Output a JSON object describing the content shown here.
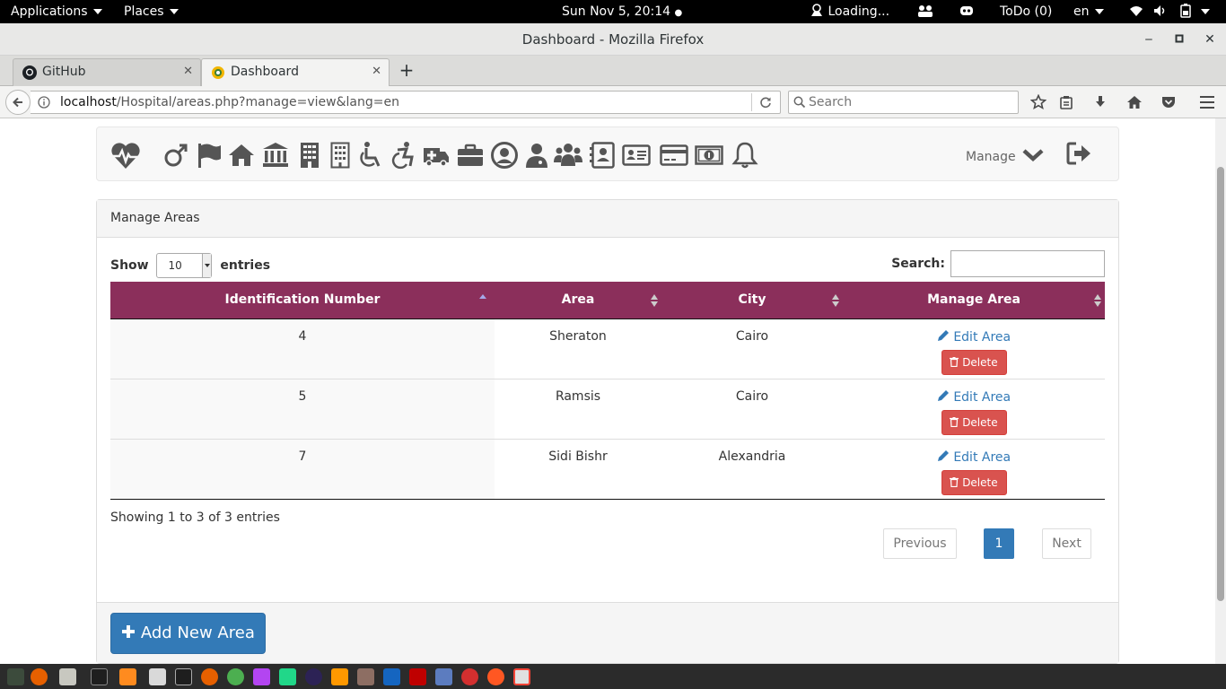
{
  "topbar": {
    "applications": "Applications",
    "places": "Places",
    "clock": "Sun Nov  5, 20:14",
    "loading": "Loading...",
    "todo": "ToDo (0)",
    "lang": "en"
  },
  "window": {
    "title": "Dashboard - Mozilla Firefox"
  },
  "tabs": [
    {
      "label": "GitHub"
    },
    {
      "label": "Dashboard"
    }
  ],
  "nav": {
    "url_host": "localhost",
    "url_path": "/Hospital/areas.php?manage=view&lang=en",
    "search_placeholder": "Search"
  },
  "app_nav": {
    "manage_label": "Manage"
  },
  "panel": {
    "heading": "Manage Areas"
  },
  "table_controls": {
    "show_label": "Show",
    "entries_label": "entries",
    "page_length": "10",
    "search_label": "Search:"
  },
  "table": {
    "columns": [
      "Identification Number",
      "Area",
      "City",
      "Manage Area"
    ],
    "rows": [
      {
        "id": "4",
        "area": "Sheraton",
        "city": "Cairo"
      },
      {
        "id": "5",
        "area": "Ramsis",
        "city": "Cairo"
      },
      {
        "id": "7",
        "area": "Sidi Bishr",
        "city": "Alexandria"
      }
    ],
    "edit_label": "Edit Area",
    "delete_label": "Delete"
  },
  "pagination": {
    "info": "Showing 1 to 3 of 3 entries",
    "previous": "Previous",
    "current": "1",
    "next": "Next"
  },
  "footer": {
    "add_label": "Add New Area"
  },
  "colors": {
    "table_header": "#8b2f5b",
    "primary": "#337ab7",
    "danger": "#d9534f"
  }
}
